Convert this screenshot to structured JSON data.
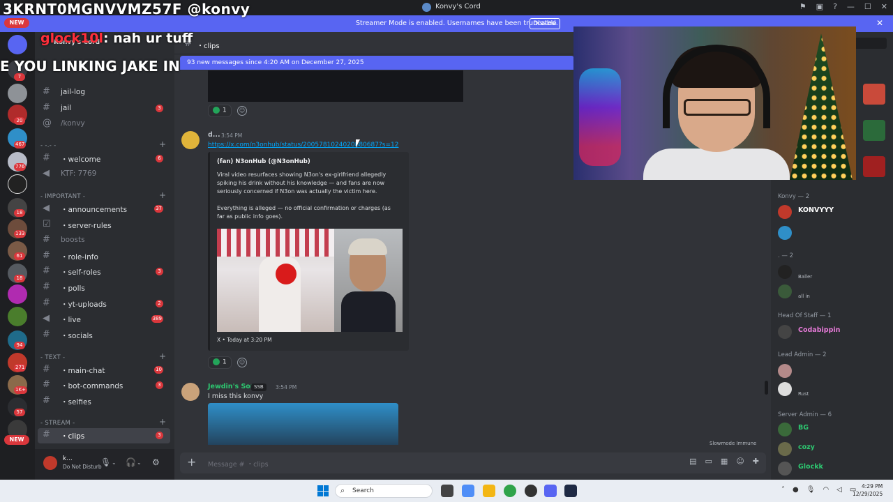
{
  "window": {
    "title": "Konvy's Cord"
  },
  "overlay": {
    "line1": "3KRNT0MGNVVMZ57F @konvy",
    "line2_name": "glock10l",
    "line2_text": ": nah ur tuff",
    "line3": "E YOU LINKING JAKE IN"
  },
  "banner": {
    "text": "Streamer Mode is enabled. Usernames have been truncated.",
    "button": "Disable"
  },
  "rail": {
    "new_top": "NEW",
    "new_bottom": "NEW",
    "badges": [
      "7",
      "20",
      "467",
      "776",
      "18",
      "133",
      "61",
      "18",
      "94",
      "271",
      "1K+",
      "57"
    ]
  },
  "sidebar": {
    "server_name": "Konvy's Cord",
    "channels_top": [
      {
        "label": "jail-log",
        "badge": ""
      },
      {
        "label": "jail",
        "badge": "3"
      },
      {
        "label": "/konvy",
        "badge": ""
      }
    ],
    "cat_misc": "- -.- -",
    "welcome": {
      "label": "・welcome",
      "badge": "6"
    },
    "ktf": "KTF: 7769",
    "cat_important": "- IMPORTANT -",
    "important": [
      {
        "label": "・announcements",
        "badge": "37"
      },
      {
        "label": "・server-rules",
        "badge": ""
      },
      {
        "label": "boosts",
        "badge": ""
      },
      {
        "label": "・role-info",
        "badge": ""
      },
      {
        "label": "・self-roles",
        "badge": "3"
      },
      {
        "label": "・polls",
        "badge": ""
      },
      {
        "label": "・yt-uploads",
        "badge": "2"
      },
      {
        "label": "・live",
        "badge": "389"
      },
      {
        "label": "・socials",
        "badge": ""
      }
    ],
    "cat_text": "- TEXT -",
    "text": [
      {
        "label": "・main-chat",
        "badge": "10"
      },
      {
        "label": "・bot-commands",
        "badge": "3"
      },
      {
        "label": "・selfies",
        "badge": ""
      }
    ],
    "cat_stream": "- STREAM -",
    "stream": [
      {
        "label": "・clips",
        "badge": "3"
      }
    ],
    "user": {
      "name": "k...",
      "status": "Do Not Disturb"
    }
  },
  "chat": {
    "channel": "・clips",
    "new_messages": "93 new messages since 4:20 AM on December 27, 2025",
    "reaction1_count": "1",
    "msg1": {
      "author": "d...",
      "time": "3:54 PM",
      "link": "https://x.com/n3onhub/status/2005781024020880687?s=12",
      "embed_title": "(fan) N3onHub (@N3onHub)",
      "embed_desc": "Viral video resurfaces showing N3on's ex-girlfriend allegedly spiking his drink without his knowledge — and fans are now seriously concerned if N3on was actually the victim here.",
      "embed_desc2": "Everything is alleged — no official confirmation or charges (as far as public info goes).",
      "embed_footer": "X • Today at 3:20 PM"
    },
    "reaction2_count": "1",
    "msg2": {
      "author": "Jewdin's Son",
      "tag": "SSB",
      "time": "3:54 PM",
      "text": "I miss this konvy"
    },
    "slowmode": "Slowmode Immune",
    "composer_placeholder": "Message # ・clips"
  },
  "members": {
    "group_konvy": "Konvy — 2",
    "konvy_member": "KONVYYY",
    "group_dot": ". — 2",
    "member_baller_sub": "Baller",
    "member_allin_sub": "all in",
    "group_head": "Head Of Staff — 1",
    "head_member": "Codabippin",
    "group_lead": "Lead Admin — 2",
    "lead_sub": "Rust",
    "group_server": "Server Admin — 6",
    "server_members": [
      "BG",
      "cozy",
      "Glockk"
    ]
  },
  "taskbar": {
    "search": "Search",
    "time": "4:29 PM",
    "date": "12/29/2025"
  },
  "colors": {
    "brand": "#5865f2",
    "badge": "#da373c",
    "link": "#00a8fc",
    "online": "#23a55a"
  }
}
